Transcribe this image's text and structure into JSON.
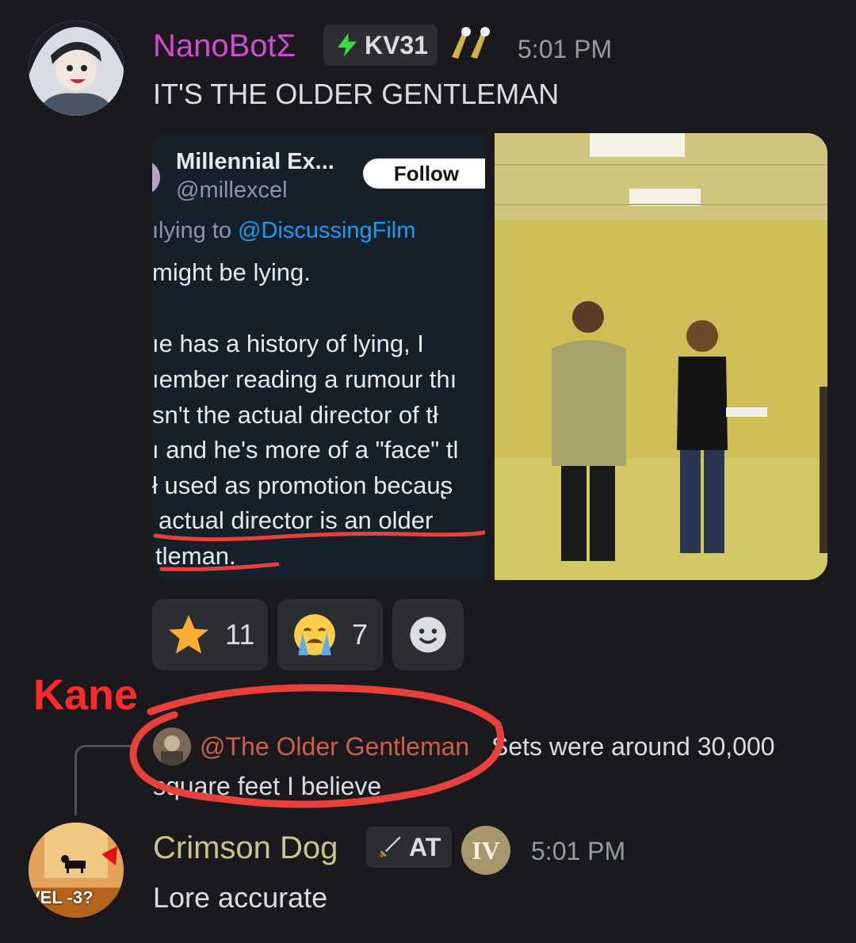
{
  "message1": {
    "username": "NanoBotΣ",
    "username_color": "#d44bd1",
    "tag": "KV31",
    "tag_icon": "lightning-icon",
    "time": "5:01 PM",
    "text": "IT'S THE OLDER GENTLEMAN"
  },
  "tweet": {
    "display_name": "Millennial Ex...",
    "handle": "@millexcel",
    "follow_label": "Follow",
    "replying_prefix": "ılying to ",
    "replying_to": "@DiscussingFilm",
    "lines": [
      "might be lying.",
      "ıe has a history of lying, I",
      "ıember reading a rumour thı",
      "sn't the actual director of tł",
      "ı and he's more of a \"face\" tl",
      "ł used as promotion becauʂ",
      "actual director is an older",
      "tleman."
    ]
  },
  "reactions": [
    {
      "icon": "star-icon",
      "count": "11"
    },
    {
      "icon": "crying-face-icon",
      "count": "7"
    },
    {
      "icon": "add-reaction-icon",
      "count": ""
    }
  ],
  "annotation": {
    "label": "Kane",
    "color": "#ff2a2a"
  },
  "reply": {
    "mention": "@The Older Gentleman",
    "mention_color": "#c8614b",
    "line1": "Sets were around 30,000",
    "line2": "square feet I believe"
  },
  "message2": {
    "username": "Crimson Dog",
    "username_color": "#c9c38d",
    "tag": "AT",
    "tag_icon": "sword-icon",
    "badge": "IV",
    "time": "5:01 PM",
    "text": "Lore accurate",
    "avatar_text": "VEL -3?"
  }
}
